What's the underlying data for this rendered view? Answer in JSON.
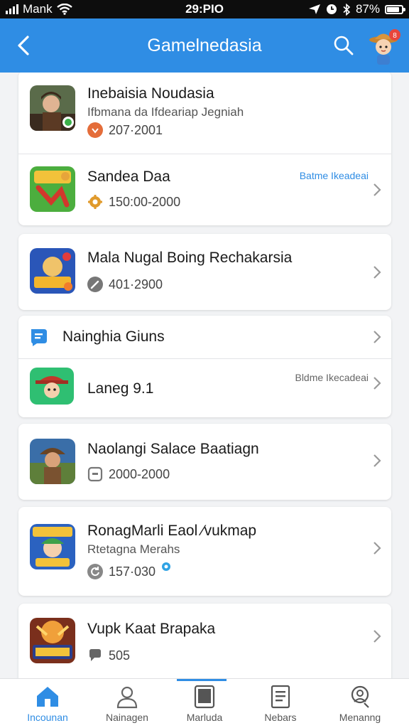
{
  "status_bar": {
    "carrier": "Mank",
    "time": "29:PIO",
    "battery": "87%",
    "icons": [
      "signal-icon",
      "wifi-icon",
      "location-icon",
      "alarm-icon",
      "bluetooth-icon",
      "battery-icon"
    ]
  },
  "header": {
    "title": "Gamelnedasia",
    "back_icon": "chevron-left-icon",
    "search_icon": "search-icon",
    "avatar_icon": "avatar-icon",
    "color": "#2f8de4"
  },
  "list": {
    "items": [
      {
        "title": "Inebaisia Noudasia",
        "subtitle": "Ifbmana da Ifdeariap Jegniah",
        "meta": "207·2001",
        "meta_icon": "badge-icon"
      },
      {
        "title": "Sandea Daa",
        "tag": "Batme Ikeadeai",
        "meta": "150:00-2000",
        "meta_icon": "gear-icon"
      },
      {
        "title": "Mala Nugal Boing Rechakarsia",
        "meta": "401·2900",
        "meta_icon": "wrench-icon"
      },
      {
        "title": "Nainghia Giuns",
        "icon": "chat-icon"
      },
      {
        "title": "Laneg 9.1",
        "tag": "Bldme Ikecadeai"
      },
      {
        "title": "Naolangi Salace Baatiagn",
        "meta": "2000-2000",
        "meta_icon": "square-icon"
      },
      {
        "title": "RonagMarli Eaol ⁄vukmap",
        "subtitle": "Rtetagna Merahs",
        "meta": "157·030",
        "meta_icon": "refresh-icon"
      },
      {
        "title": "Vupk Kaat Brapaka",
        "meta": "505",
        "meta_icon": "comment-icon"
      }
    ]
  },
  "bottom_nav": {
    "items": [
      {
        "label": "Incounan",
        "icon": "home-icon",
        "active": true
      },
      {
        "label": "Nainagen",
        "icon": "user-icon",
        "active": false
      },
      {
        "label": "Marluda",
        "icon": "tablet-icon",
        "active": false
      },
      {
        "label": "Nebars",
        "icon": "document-icon",
        "active": false
      },
      {
        "label": "Menanng",
        "icon": "profile-icon",
        "active": false
      }
    ]
  },
  "colors": {
    "accent": "#2f8de4",
    "background": "#f2f3f5",
    "tag": "#2f8de4",
    "tag_muted": "#666666"
  }
}
